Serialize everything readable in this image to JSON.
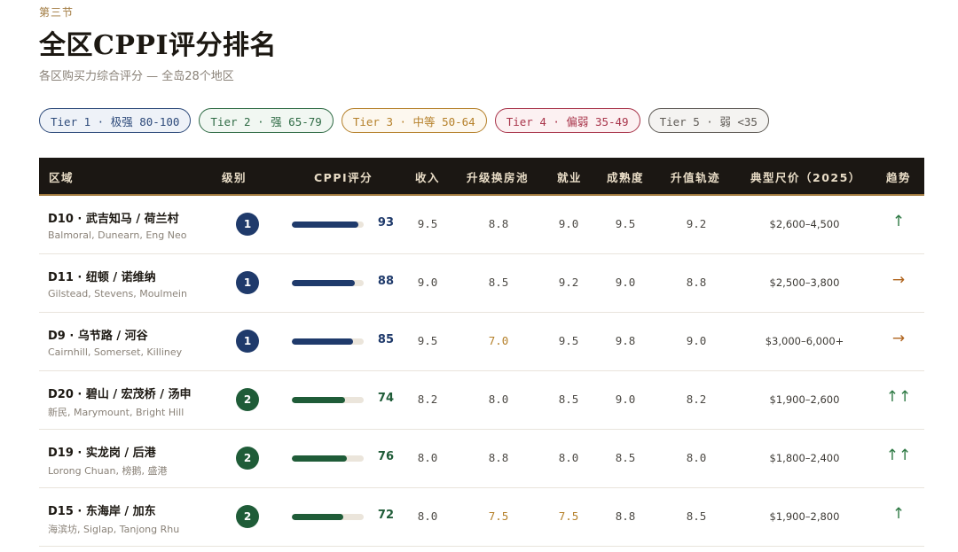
{
  "section_label": "第三节",
  "title": "全区CPPI评分排名",
  "subtitle": "各区购买力综合评分 — 全岛28个地区",
  "tiers": [
    {
      "label": "Tier 1 · 极强 80-100",
      "color": "#2d4a7a",
      "bg": "#eef2f8"
    },
    {
      "label": "Tier 2 · 强 65-79",
      "color": "#2f6b45",
      "bg": "#f1f7f2"
    },
    {
      "label": "Tier 3 · 中等 50-64",
      "color": "#b5802a",
      "bg": "#fdf8ef"
    },
    {
      "label": "Tier 4 · 偏弱 35-49",
      "color": "#a8344a",
      "bg": "#fcf1f2"
    },
    {
      "label": "Tier 5 · 弱 <35",
      "color": "#5e5a55",
      "bg": "#f4f3f1"
    }
  ],
  "columns": {
    "region": "区域",
    "tier": "级别",
    "cppi": "CPPI评分",
    "income": "收入",
    "upgrade": "升级换房池",
    "employment": "就业",
    "maturity": "成熟度",
    "appreciation": "升值轨迹",
    "price": "典型尺价（2025）",
    "trend": "趋势"
  },
  "colors": {
    "tier1": "#1f3a6b",
    "tier2": "#1f5c38",
    "highlight": "#b5802a",
    "trend_up": "#2f7a45",
    "trend_flat": "#b0651f"
  },
  "rows": [
    {
      "name": "D10 · 武吉知马 / 荷兰村",
      "sub": "Balmoral, Dunearn, Eng Neo",
      "tier": "1",
      "cppi": 93,
      "income": "9.5",
      "upgrade": "8.8",
      "employment": "9.0",
      "maturity": "9.5",
      "appreciation": "9.2",
      "price": "$2,600–4,500",
      "trend": "↑"
    },
    {
      "name": "D11 · 纽顿 / 诺维纳",
      "sub": "Gilstead, Stevens, Moulmein",
      "tier": "1",
      "cppi": 88,
      "income": "9.0",
      "upgrade": "8.5",
      "employment": "9.2",
      "maturity": "9.0",
      "appreciation": "8.8",
      "price": "$2,500–3,800",
      "trend": "→"
    },
    {
      "name": "D9 · 乌节路 / 河谷",
      "sub": "Cairnhill, Somerset, Killiney",
      "tier": "1",
      "cppi": 85,
      "income": "9.5",
      "upgrade": "7.0",
      "employment": "9.5",
      "maturity": "9.8",
      "appreciation": "9.0",
      "price": "$3,000–6,000+",
      "trend": "→"
    },
    {
      "name": "D20 · 碧山 / 宏茂桥 / 汤申",
      "sub": "新民, Marymount, Bright Hill",
      "tier": "2",
      "cppi": 74,
      "income": "8.2",
      "upgrade": "8.0",
      "employment": "8.5",
      "maturity": "9.0",
      "appreciation": "8.2",
      "price": "$1,900–2,600",
      "trend": "↑↑"
    },
    {
      "name": "D19 · 实龙岗 / 后港",
      "sub": "Lorong Chuan, 榜鹅, 盛港",
      "tier": "2",
      "cppi": 76,
      "income": "8.0",
      "upgrade": "8.8",
      "employment": "8.0",
      "maturity": "8.5",
      "appreciation": "8.0",
      "price": "$1,800–2,400",
      "trend": "↑↑"
    },
    {
      "name": "D15 · 东海岸 / 加东",
      "sub": "海滨坊, Siglap, Tanjong Rhu",
      "tier": "2",
      "cppi": 72,
      "income": "8.0",
      "upgrade": "7.5",
      "employment": "7.5",
      "maturity": "8.8",
      "appreciation": "8.5",
      "price": "$1,900–2,800",
      "trend": "↑"
    }
  ]
}
